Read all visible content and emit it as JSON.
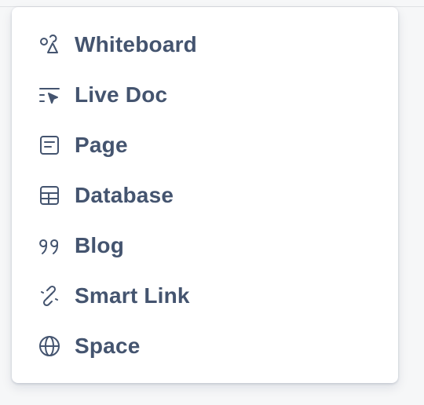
{
  "menu": {
    "items": [
      {
        "label": "Whiteboard",
        "icon": "whiteboard-shapes-icon"
      },
      {
        "label": "Live Doc",
        "icon": "live-doc-icon"
      },
      {
        "label": "Page",
        "icon": "page-icon"
      },
      {
        "label": "Database",
        "icon": "database-table-icon"
      },
      {
        "label": "Blog",
        "icon": "quote-icon"
      },
      {
        "label": "Smart Link",
        "icon": "link-icon"
      },
      {
        "label": "Space",
        "icon": "globe-icon"
      }
    ]
  },
  "colors": {
    "icon_and_text": "#44546f",
    "menu_background": "#ffffff",
    "page_background": "#f6f7f8"
  }
}
